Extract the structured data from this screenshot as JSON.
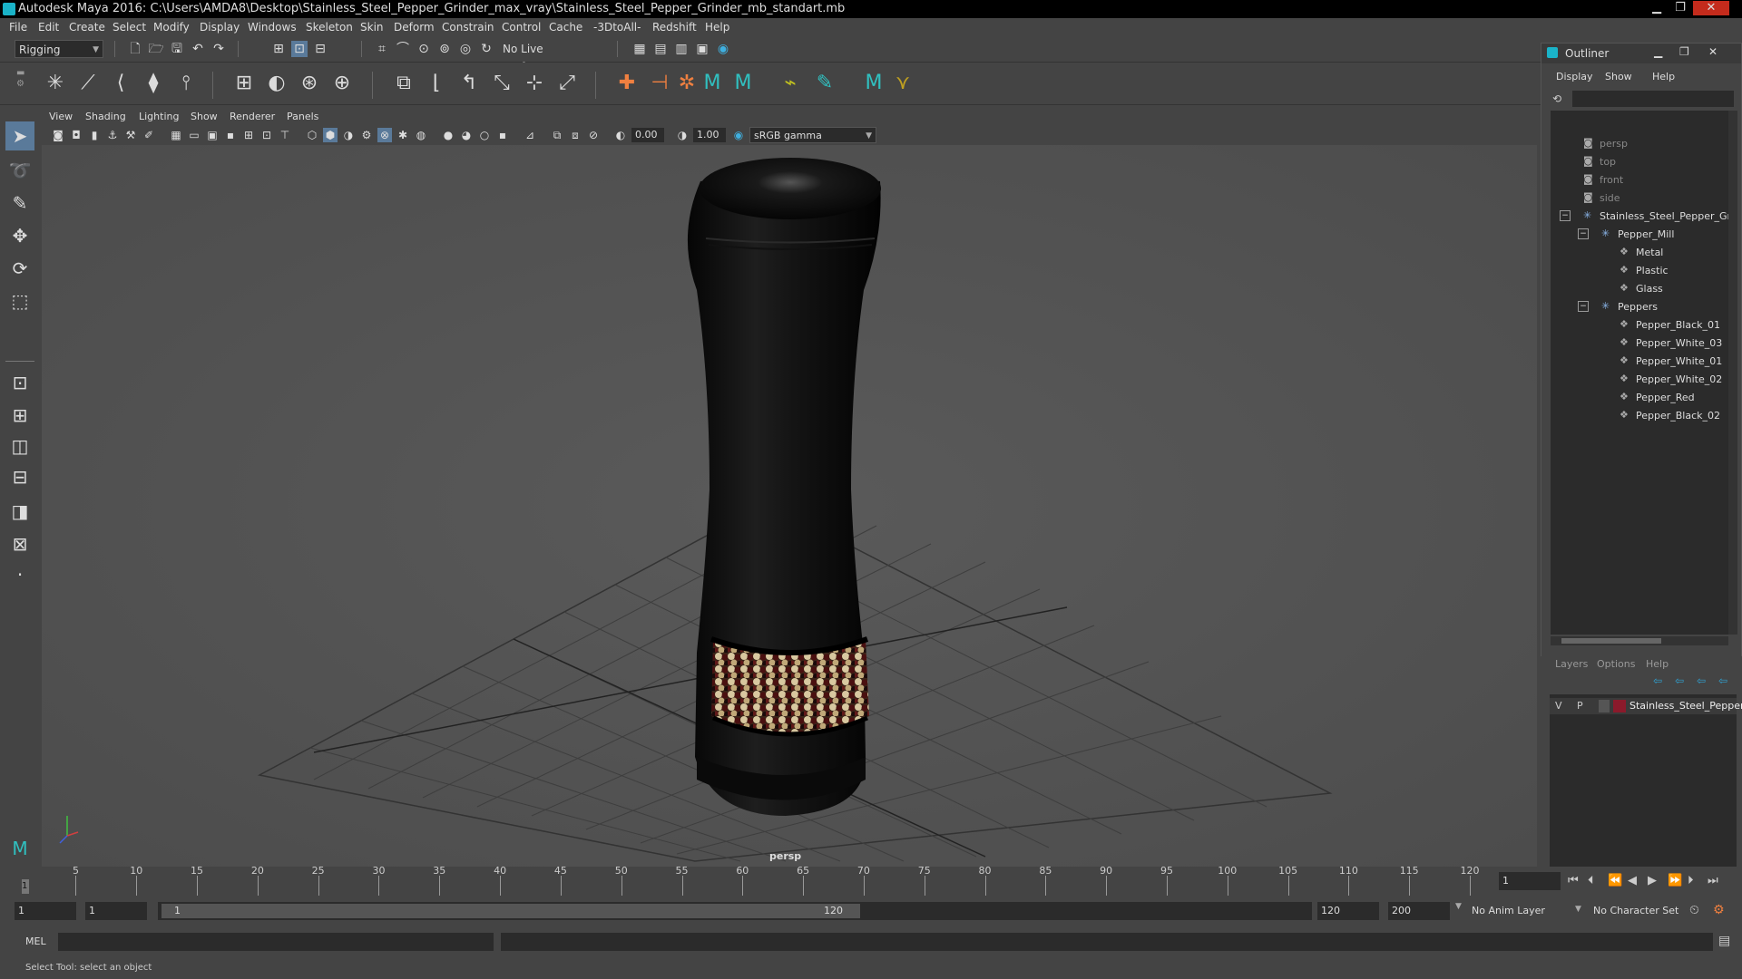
{
  "window": {
    "title": "Autodesk Maya 2016: C:\\Users\\AMDA8\\Desktop\\Stainless_Steel_Pepper_Grinder_max_vray\\Stainless_Steel_Pepper_Grinder_mb_standart.mb",
    "minimize": "▁",
    "maximize": "❐",
    "close": "✕"
  },
  "menubar": [
    "File",
    "Edit",
    "Create",
    "Select",
    "Modify",
    "Display",
    "Windows",
    "Skeleton",
    "Skin",
    "Deform",
    "Constrain",
    "Control",
    "Cache",
    "-3DtoAll-",
    "Redshift",
    "Help"
  ],
  "statusline": {
    "menuset": "Rigging",
    "live_surface": "No Live Surface"
  },
  "viewport": {
    "menu": [
      "View",
      "Shading",
      "Lighting",
      "Show",
      "Renderer",
      "Panels"
    ],
    "exposure": "0.00",
    "gamma": "1.00",
    "colorspace": "sRGB gamma",
    "camera_label": "persp"
  },
  "outliner": {
    "title": "Outliner",
    "menu": [
      "Display",
      "Show",
      "Help"
    ],
    "items": [
      {
        "label": "persp",
        "depth": 0,
        "dim": true,
        "icon": "camera-icon"
      },
      {
        "label": "top",
        "depth": 0,
        "dim": true,
        "icon": "camera-icon"
      },
      {
        "label": "front",
        "depth": 0,
        "dim": true,
        "icon": "camera-icon"
      },
      {
        "label": "side",
        "depth": 0,
        "dim": true,
        "icon": "camera-icon"
      },
      {
        "label": "Stainless_Steel_Pepper_Gr",
        "depth": 0,
        "dim": false,
        "icon": "group-icon",
        "expand": "−"
      },
      {
        "label": "Pepper_Mill",
        "depth": 1,
        "dim": false,
        "icon": "group-icon",
        "expand": "−"
      },
      {
        "label": "Metal",
        "depth": 2,
        "dim": false,
        "icon": "mesh-icon"
      },
      {
        "label": "Plastic",
        "depth": 2,
        "dim": false,
        "icon": "mesh-icon"
      },
      {
        "label": "Glass",
        "depth": 2,
        "dim": false,
        "icon": "mesh-icon"
      },
      {
        "label": "Peppers",
        "depth": 1,
        "dim": false,
        "icon": "group-icon",
        "expand": "−"
      },
      {
        "label": "Pepper_Black_01",
        "depth": 2,
        "dim": false,
        "icon": "mesh-icon"
      },
      {
        "label": "Pepper_White_03",
        "depth": 2,
        "dim": false,
        "icon": "mesh-icon"
      },
      {
        "label": "Pepper_White_01",
        "depth": 2,
        "dim": false,
        "icon": "mesh-icon"
      },
      {
        "label": "Pepper_White_02",
        "depth": 2,
        "dim": false,
        "icon": "mesh-icon"
      },
      {
        "label": "Pepper_Red",
        "depth": 2,
        "dim": false,
        "icon": "mesh-icon"
      },
      {
        "label": "Pepper_Black_02",
        "depth": 2,
        "dim": false,
        "icon": "mesh-icon"
      }
    ]
  },
  "layers": {
    "menu": [
      "Layers",
      "Options",
      "Help"
    ],
    "row": {
      "v": "V",
      "p": "P",
      "name": "Stainless_Steel_Pepper",
      "color": "#8b1a2b"
    }
  },
  "timeline": {
    "ticks": [
      1,
      5,
      10,
      15,
      20,
      25,
      30,
      35,
      40,
      45,
      50,
      55,
      60,
      65,
      70,
      75,
      80,
      85,
      90,
      95,
      100,
      105,
      110,
      115,
      120
    ],
    "labels": [
      "5",
      "10",
      "15",
      "20",
      "25",
      "30",
      "35",
      "40",
      "45",
      "50",
      "55",
      "60",
      "65",
      "70",
      "75",
      "80",
      "85",
      "90",
      "95",
      "100",
      "105",
      "110",
      "115",
      "120"
    ],
    "current_frame_marker": "1",
    "current_frame_field": "1"
  },
  "range": {
    "start": "1",
    "playback_start": "1",
    "slider_start": "1",
    "slider_end": "120",
    "playback_end": "120",
    "end": "200",
    "anim_layer": "No Anim Layer",
    "character_set": "No Character Set"
  },
  "command": {
    "language": "MEL"
  },
  "help_line": "Select Tool: select an object",
  "colors": {
    "accent": "#1ab3c8",
    "layer_color": "#8b1a2b"
  }
}
